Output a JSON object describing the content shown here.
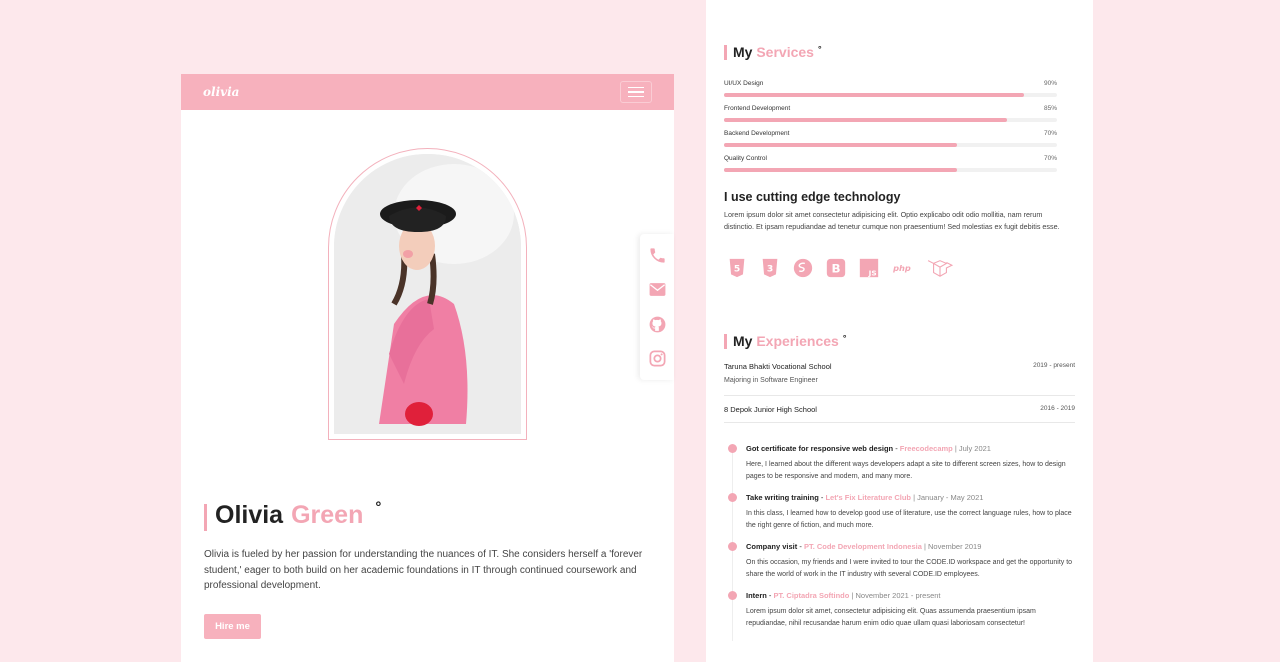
{
  "nav": {
    "brand": "olivia"
  },
  "hero": {
    "first_name": "Olivia",
    "last_name": "Green",
    "degree": "°",
    "description": "Olivia is fueled by her passion for understanding the nuances of IT. She considers herself a 'forever student,' eager to both build on her academic foundations in IT through continued coursework and professional development.",
    "hire_label": "Hire me"
  },
  "socials": [
    "phone-icon",
    "mail-icon",
    "github-icon",
    "instagram-icon"
  ],
  "services": {
    "title_plain": "My",
    "title_accent": "Services",
    "degree": "°",
    "items": [
      {
        "name": "UI/UX Design",
        "percent_label": "90%",
        "level": 0.9
      },
      {
        "name": "Frontend Development",
        "percent_label": "85%",
        "level": 0.85
      },
      {
        "name": "Backend Development",
        "percent_label": "70%",
        "level": 0.7
      },
      {
        "name": "Quality Control",
        "percent_label": "70%",
        "level": 0.7
      }
    ]
  },
  "tech": {
    "heading": "I use cutting edge technology",
    "body": "Lorem ipsum dolor sit amet consectetur adipisicing elit. Optio explicabo odit odio mollitia, nam rerum distinctio. Et ipsam repudiandae ad tenetur cumque non praesentium! Sed molestias ex fugit debitis esse.",
    "icons": [
      "html5-icon",
      "css3-icon",
      "sass-icon",
      "bootstrap-icon",
      "javascript-icon",
      "php-icon",
      "laravel-icon"
    ]
  },
  "experiences": {
    "title_plain": "My",
    "title_accent": "Experiences",
    "degree": "°",
    "education": [
      {
        "school": "Taruna Bhakti Vocational School",
        "years": "2019 - present",
        "subtitle": "Majoring in Software Engineer"
      },
      {
        "school": "8 Depok Junior High School",
        "years": "2016 - 2019",
        "subtitle": ""
      }
    ],
    "timeline": [
      {
        "title": "Got certificate for responsive web design",
        "sep": " - ",
        "org": "Freecodecamp",
        "date": " | July 2021",
        "desc": "Here, I learned about the different ways developers adapt a site to different screen sizes, how to design pages to be responsive and modern, and many more."
      },
      {
        "title": "Take writing training",
        "sep": " - ",
        "org": "Let's Fix Literature Club",
        "date": " | January - May 2021",
        "desc": "In this class, I learned how to develop good use of literature, use the correct language rules, how to place the right genre of fiction, and much more."
      },
      {
        "title": "Company visit",
        "sep": " - ",
        "org": "PT. Code Development Indonesia",
        "date": " | November 2019",
        "desc": "On this occasion, my friends and I were invited to tour the CODE.ID workspace and get the opportunity to share the world of work in the IT industry with several CODE.ID employees."
      },
      {
        "title": "Intern",
        "sep": " - ",
        "org": "PT. Ciptadra Softindo",
        "date": " | November 2021 - present",
        "desc": "Lorem ipsum dolor sit amet, consectetur adipisicing elit. Quas assumenda praesentium ipsam repudiandae, nihil recusandae harum enim odio quae ullam quasi laboriosam consectetur!"
      }
    ]
  },
  "colors": {
    "accent": "#f3a6b4",
    "navbar": "#f7b1bd",
    "background": "#fde8ec"
  }
}
